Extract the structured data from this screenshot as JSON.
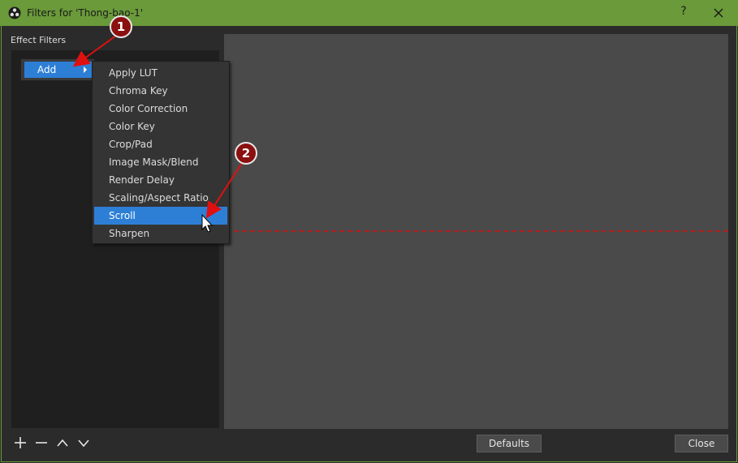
{
  "window": {
    "title": "Filters for 'Thong-bao-1'",
    "help_label": "?"
  },
  "sidebar": {
    "section_label": "Effect Filters"
  },
  "menu": {
    "add_label": "Add",
    "items": [
      "Apply LUT",
      "Chroma Key",
      "Color Correction",
      "Color Key",
      "Crop/Pad",
      "Image Mask/Blend",
      "Render Delay",
      "Scaling/Aspect Ratio",
      "Scroll",
      "Sharpen"
    ],
    "highlighted_item": "Scroll"
  },
  "toolbar": {
    "icons": [
      "plus-icon",
      "minus-icon",
      "chevron-up-icon",
      "chevron-down-icon"
    ]
  },
  "buttons": {
    "defaults": "Defaults",
    "close": "Close"
  },
  "annotations": {
    "step1": "1",
    "step2": "2"
  },
  "colors": {
    "titlebar": "#6a9a3a",
    "accent": "#2d7fd6",
    "badge": "#8b1010",
    "arrow": "#e01010"
  }
}
